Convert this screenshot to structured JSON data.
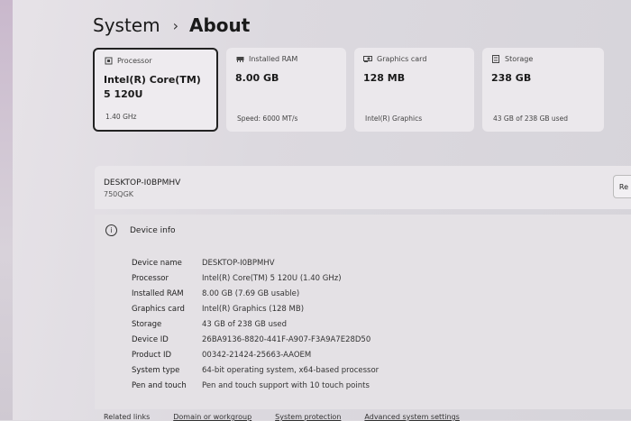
{
  "breadcrumb": {
    "root": "System",
    "current": "About"
  },
  "specs": [
    {
      "label": "Processor",
      "value": "Intel(R) Core(TM) 5 120U",
      "sub": "1.40 GHz",
      "icon": "processor-icon"
    },
    {
      "label": "Installed RAM",
      "value": "8.00 GB",
      "sub": "Speed: 6000 MT/s",
      "icon": "ram-icon"
    },
    {
      "label": "Graphics card",
      "value": "128 MB",
      "sub": "Intel(R) Graphics",
      "icon": "graphics-card-icon"
    },
    {
      "label": "Storage",
      "value": "238 GB",
      "sub": "43 GB of 238 GB used",
      "icon": "storage-icon"
    }
  ],
  "device": {
    "name": "DESKTOP-I0BPMHV",
    "model": "750QGK",
    "rename_label": "Re"
  },
  "device_info": {
    "title": "Device info",
    "rows": [
      {
        "label": "Device name",
        "value": "DESKTOP-I0BPMHV"
      },
      {
        "label": "Processor",
        "value": "Intel(R) Core(TM) 5 120U (1.40 GHz)"
      },
      {
        "label": "Installed RAM",
        "value": "8.00 GB (7.69 GB usable)"
      },
      {
        "label": "Graphics card",
        "value": "Intel(R) Graphics (128 MB)"
      },
      {
        "label": "Storage",
        "value": "43 GB of 238 GB used"
      },
      {
        "label": "Device ID",
        "value": "26BA9136-8820-441F-A907-F3A9A7E28D50"
      },
      {
        "label": "Product ID",
        "value": "00342-21424-25663-AAOEM"
      },
      {
        "label": "System type",
        "value": "64-bit operating system, x64-based processor"
      },
      {
        "label": "Pen and touch",
        "value": "Pen and touch support with 10 touch points"
      }
    ]
  },
  "bottom_links": [
    "Related links",
    "Domain or workgroup",
    "System protection",
    "Advanced system settings"
  ]
}
